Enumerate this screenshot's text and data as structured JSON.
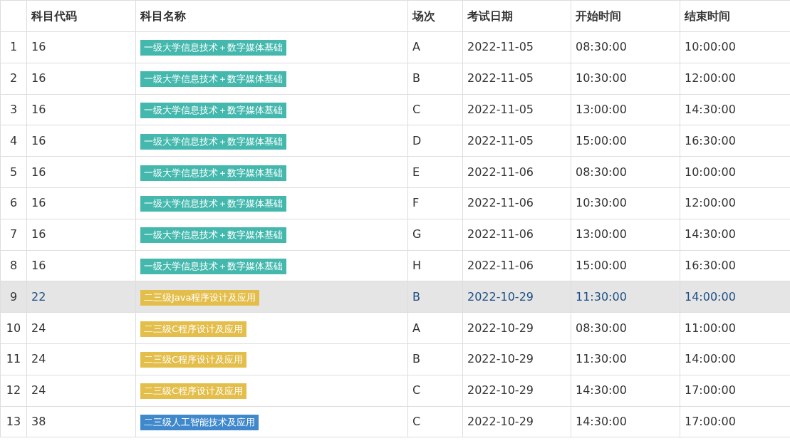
{
  "table": {
    "columns": [
      "科目代码",
      "科目名称",
      "场次",
      "考试日期",
      "开始时间",
      "结束时间"
    ],
    "rows": [
      {
        "index": "1",
        "code": "16",
        "subject": "一级大学信息技术＋数字媒体基础",
        "color": "#45b8ae",
        "session": "A",
        "date": "2022-11-05",
        "start": "08:30:00",
        "end": "10:00:00",
        "selected": false
      },
      {
        "index": "2",
        "code": "16",
        "subject": "一级大学信息技术＋数字媒体基础",
        "color": "#45b8ae",
        "session": "B",
        "date": "2022-11-05",
        "start": "10:30:00",
        "end": "12:00:00",
        "selected": false
      },
      {
        "index": "3",
        "code": "16",
        "subject": "一级大学信息技术＋数字媒体基础",
        "color": "#45b8ae",
        "session": "C",
        "date": "2022-11-05",
        "start": "13:00:00",
        "end": "14:30:00",
        "selected": false
      },
      {
        "index": "4",
        "code": "16",
        "subject": "一级大学信息技术＋数字媒体基础",
        "color": "#45b8ae",
        "session": "D",
        "date": "2022-11-05",
        "start": "15:00:00",
        "end": "16:30:00",
        "selected": false
      },
      {
        "index": "5",
        "code": "16",
        "subject": "一级大学信息技术＋数字媒体基础",
        "color": "#45b8ae",
        "session": "E",
        "date": "2022-11-06",
        "start": "08:30:00",
        "end": "10:00:00",
        "selected": false
      },
      {
        "index": "6",
        "code": "16",
        "subject": "一级大学信息技术＋数字媒体基础",
        "color": "#45b8ae",
        "session": "F",
        "date": "2022-11-06",
        "start": "10:30:00",
        "end": "12:00:00",
        "selected": false
      },
      {
        "index": "7",
        "code": "16",
        "subject": "一级大学信息技术＋数字媒体基础",
        "color": "#45b8ae",
        "session": "G",
        "date": "2022-11-06",
        "start": "13:00:00",
        "end": "14:30:00",
        "selected": false
      },
      {
        "index": "8",
        "code": "16",
        "subject": "一级大学信息技术＋数字媒体基础",
        "color": "#45b8ae",
        "session": "H",
        "date": "2022-11-06",
        "start": "15:00:00",
        "end": "16:30:00",
        "selected": false
      },
      {
        "index": "9",
        "code": "22",
        "subject": "二三级Java程序设计及应用",
        "color": "#e4be4a",
        "session": "B",
        "date": "2022-10-29",
        "start": "11:30:00",
        "end": "14:00:00",
        "selected": true
      },
      {
        "index": "10",
        "code": "24",
        "subject": "二三级C程序设计及应用",
        "color": "#e4be4a",
        "session": "A",
        "date": "2022-10-29",
        "start": "08:30:00",
        "end": "11:00:00",
        "selected": false
      },
      {
        "index": "11",
        "code": "24",
        "subject": "二三级C程序设计及应用",
        "color": "#e4be4a",
        "session": "B",
        "date": "2022-10-29",
        "start": "11:30:00",
        "end": "14:00:00",
        "selected": false
      },
      {
        "index": "12",
        "code": "24",
        "subject": "二三级C程序设计及应用",
        "color": "#e4be4a",
        "session": "C",
        "date": "2022-10-29",
        "start": "14:30:00",
        "end": "17:00:00",
        "selected": false
      },
      {
        "index": "13",
        "code": "38",
        "subject": "二三级人工智能技术及应用",
        "color": "#3f88cc",
        "session": "C",
        "date": "2022-10-29",
        "start": "14:30:00",
        "end": "17:00:00",
        "selected": false
      }
    ]
  }
}
